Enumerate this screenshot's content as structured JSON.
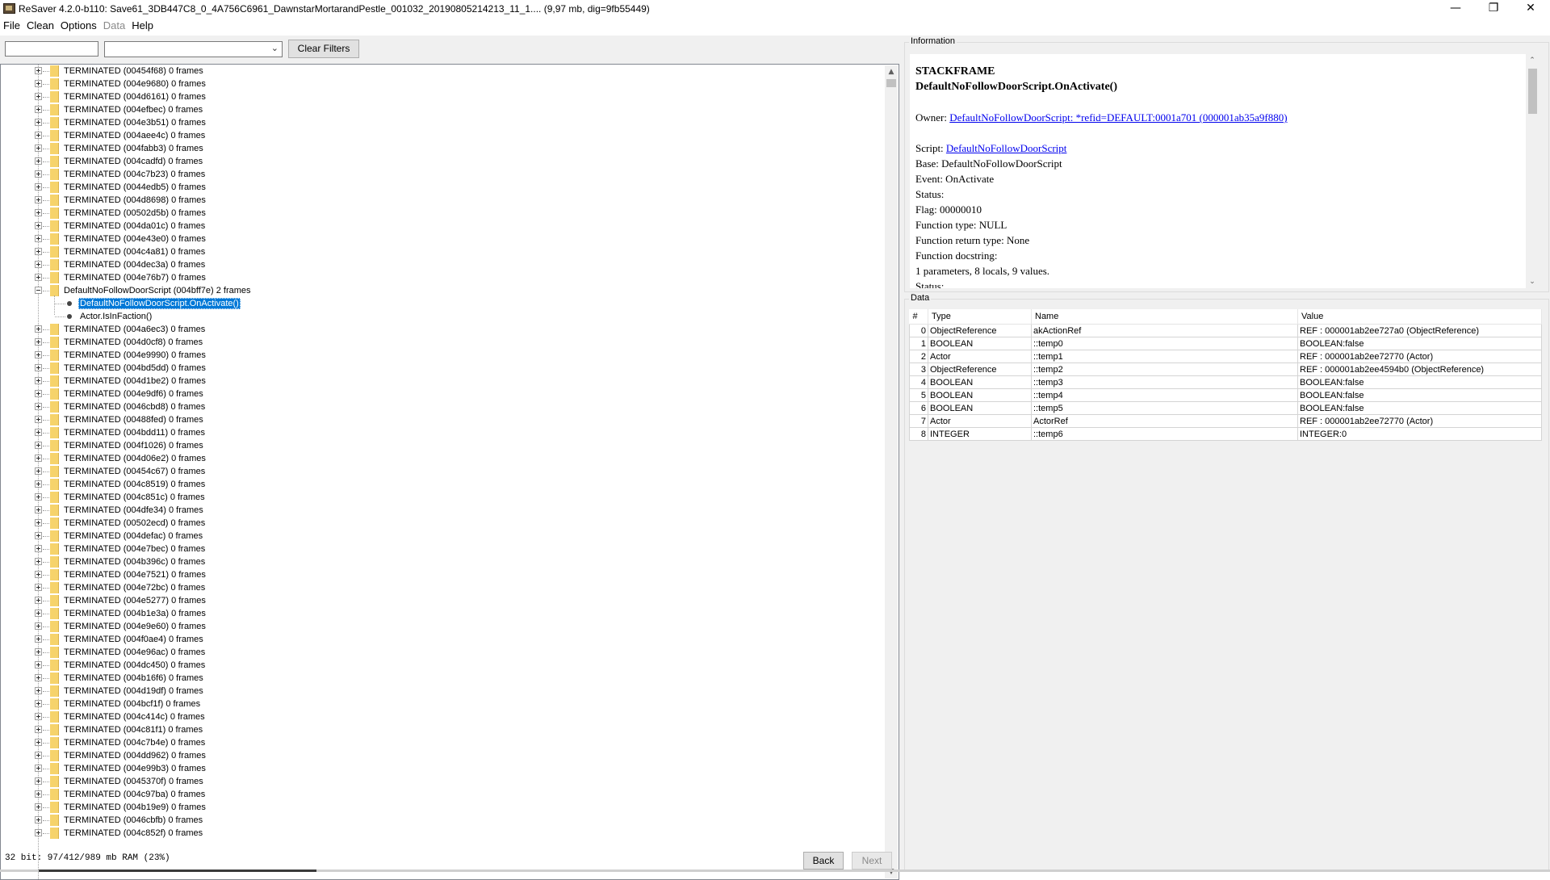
{
  "window": {
    "title": "ReSaver 4.2.0-b110: Save61_3DB447C8_0_4A756C6961_DawnstarMortarandPestle_001032_20190805214213_11_1.... (9,97 mb, dig=9fb55449)",
    "minimize_glyph": "—",
    "maximize_glyph": "❐",
    "close_glyph": "✕"
  },
  "menu": {
    "file": "File",
    "clean": "Clean",
    "options": "Options",
    "data": "Data",
    "help": "Help"
  },
  "toolbar": {
    "filter_text": "",
    "filter_select_value": "",
    "clear_filters_label": "Clear Filters"
  },
  "tree": {
    "items_before": [
      "TERMINATED (00454f68) 0 frames",
      "TERMINATED (004e9680) 0 frames",
      "TERMINATED (004d6161) 0 frames",
      "TERMINATED (004efbec) 0 frames",
      "TERMINATED (004e3b51) 0 frames",
      "TERMINATED (004aee4c) 0 frames",
      "TERMINATED (004fabb3) 0 frames",
      "TERMINATED (004cadfd) 0 frames",
      "TERMINATED (004c7b23) 0 frames",
      "TERMINATED (0044edb5) 0 frames",
      "TERMINATED (004d8698) 0 frames",
      "TERMINATED (00502d5b) 0 frames",
      "TERMINATED (004da01c) 0 frames",
      "TERMINATED (004e43e0) 0 frames",
      "TERMINATED (004c4a81) 0 frames",
      "TERMINATED (004dec3a) 0 frames",
      "TERMINATED (004e76b7) 0 frames"
    ],
    "expanded_label": "DefaultNoFollowDoorScript (004bff7e) 2 frames",
    "children": [
      "DefaultNoFollowDoorScript.OnActivate()",
      "Actor.IsInFaction()"
    ],
    "items_after": [
      "TERMINATED (004a6ec3) 0 frames",
      "TERMINATED (004d0cf8) 0 frames",
      "TERMINATED (004e9990) 0 frames",
      "TERMINATED (004bd5dd) 0 frames",
      "TERMINATED (004d1be2) 0 frames",
      "TERMINATED (004e9df6) 0 frames",
      "TERMINATED (0046cbd8) 0 frames",
      "TERMINATED (00488fed) 0 frames",
      "TERMINATED (004bdd11) 0 frames",
      "TERMINATED (004f1026) 0 frames",
      "TERMINATED (004d06e2) 0 frames",
      "TERMINATED (00454c67) 0 frames",
      "TERMINATED (004c8519) 0 frames",
      "TERMINATED (004c851c) 0 frames",
      "TERMINATED (004dfe34) 0 frames",
      "TERMINATED (00502ecd) 0 frames",
      "TERMINATED (004defac) 0 frames",
      "TERMINATED (004e7bec) 0 frames",
      "TERMINATED (004b396c) 0 frames",
      "TERMINATED (004e7521) 0 frames",
      "TERMINATED (004e72bc) 0 frames",
      "TERMINATED (004e5277) 0 frames",
      "TERMINATED (004b1e3a) 0 frames",
      "TERMINATED (004e9e60) 0 frames",
      "TERMINATED (004f0ae4) 0 frames",
      "TERMINATED (004e96ac) 0 frames",
      "TERMINATED (004dc450) 0 frames",
      "TERMINATED (004b16f6) 0 frames",
      "TERMINATED (004d19df) 0 frames",
      "TERMINATED (004bcf1f) 0 frames",
      "TERMINATED (004c414c) 0 frames",
      "TERMINATED (004c81f1) 0 frames",
      "TERMINATED (004c7b4e) 0 frames",
      "TERMINATED (004dd962) 0 frames",
      "TERMINATED (004e99b3) 0 frames",
      "TERMINATED (0045370f) 0 frames",
      "TERMINATED (004c97ba) 0 frames",
      "TERMINATED (004b19e9) 0 frames",
      "TERMINATED (0046cbfb) 0 frames",
      "TERMINATED (004c852f) 0 frames"
    ]
  },
  "status": {
    "memory_text": "32 bit: 97/412/989 mb RAM (23%)",
    "back_label": "Back",
    "next_label": "Next"
  },
  "info": {
    "legend": "Information",
    "heading1": "STACKFRAME",
    "heading2": "DefaultNoFollowDoorScript.OnActivate()",
    "owner_label": "Owner: ",
    "owner_link": "DefaultNoFollowDoorScript: *refid=DEFAULT:0001a701 (000001ab35a9f880)",
    "script_label": "Script: ",
    "script_link": "DefaultNoFollowDoorScript",
    "base": "Base: DefaultNoFollowDoorScript",
    "event": "Event: OnActivate",
    "status": "Status:",
    "flag": "Flag: 00000010",
    "function_type": "Function type: NULL",
    "function_return_type": "Function return type: None",
    "function_docstring": "Function docstring:",
    "params_summary": "1 parameters, 8 locals, 9 values.",
    "status_cut": "Status:"
  },
  "data_panel": {
    "legend": "Data",
    "headers": {
      "idx": "#",
      "type": "Type",
      "name": "Name",
      "value": "Value"
    },
    "rows": [
      {
        "idx": "0",
        "type": "ObjectReference",
        "name": "akActionRef",
        "value": "REF : 000001ab2ee727a0 (ObjectReference)"
      },
      {
        "idx": "1",
        "type": "BOOLEAN",
        "name": "::temp0",
        "value": "BOOLEAN:false"
      },
      {
        "idx": "2",
        "type": "Actor",
        "name": "::temp1",
        "value": "REF : 000001ab2ee72770 (Actor)"
      },
      {
        "idx": "3",
        "type": "ObjectReference",
        "name": "::temp2",
        "value": "REF : 000001ab2ee4594b0 (ObjectReference)"
      },
      {
        "idx": "4",
        "type": "BOOLEAN",
        "name": "::temp3",
        "value": "BOOLEAN:false"
      },
      {
        "idx": "5",
        "type": "BOOLEAN",
        "name": "::temp4",
        "value": "BOOLEAN:false"
      },
      {
        "idx": "6",
        "type": "BOOLEAN",
        "name": "::temp5",
        "value": "BOOLEAN:false"
      },
      {
        "idx": "7",
        "type": "Actor",
        "name": "ActorRef",
        "value": "REF : 000001ab2ee72770 (Actor)"
      },
      {
        "idx": "8",
        "type": "INTEGER",
        "name": "::temp6",
        "value": "INTEGER:0"
      }
    ]
  },
  "colors": {
    "selection": "#0078d7",
    "link": "#0000ee",
    "folder": "#f6d36b",
    "panel_bg": "#f0f0f0"
  },
  "icons": {
    "app": "app-icon",
    "tree_node": "folder-icon",
    "tree_leaf": "bullet-icon",
    "expand": "plus-box-icon",
    "collapse": "minus-box-icon"
  }
}
